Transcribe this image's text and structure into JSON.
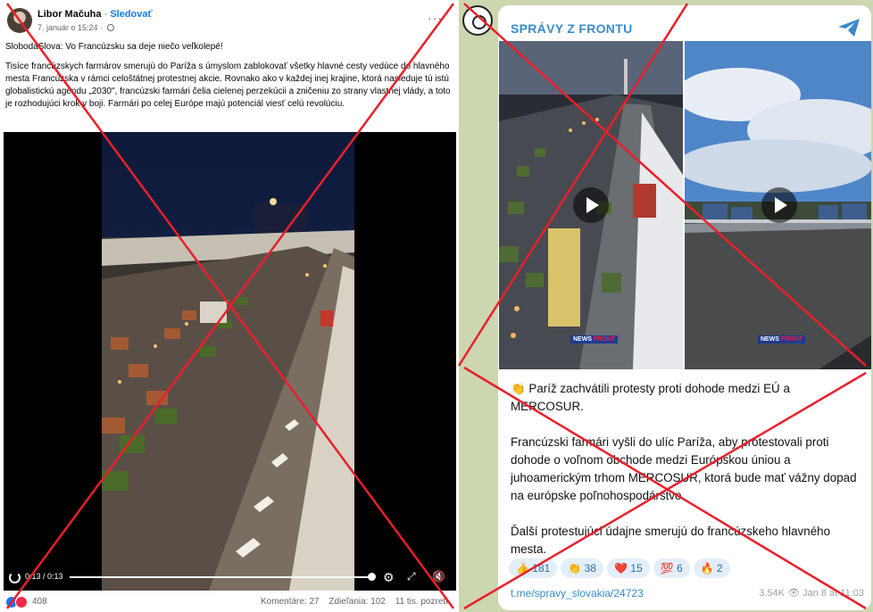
{
  "facebook": {
    "author": "Libor Mačuha",
    "separator": "·",
    "follow": "Sledovať",
    "date": "7. január o 15:24 ·",
    "more": "···",
    "line1": "SlobodaSlova: Vo Francúzsku sa deje niečo veľkolepé!",
    "body": "Tisíce francúzskych farmárov smerujú do Paríža s úmyslom zablokovať všetky hlavné cesty vedúce do hlavného mesta Francúzska v rámci celoštátnej protestnej akcie. Rovnako ako v každej inej krajine, ktorá nasleduje tú istú globalistickú agendu „2030\", francúzski farmári čelia cielenej perzekúcii a zničeniu zo strany vlastnej vlády, a toto je rozhodujúci krok v boji. Farmári po celej Európe majú potenciál viesť celú revolúciu.",
    "video": {
      "time": "0:13 / 0:13",
      "progress": 1.0,
      "settings_icon": "gear-icon",
      "fullscreen_icon": "expand-icon",
      "mute_icon": "muted-speaker-icon",
      "replay_icon": "replay-icon"
    },
    "reactions_count": "408",
    "comments": "Komentáre: 27",
    "shares": "Zdieľania: 102",
    "views": "11 tis. pozretí"
  },
  "telegram": {
    "channel": "SPRÁVY Z FRONTU",
    "share_icon": "telegram-share-icon",
    "watermark": {
      "news": "NEWS",
      "front": "FRONT"
    },
    "paragraph1": "👏 Paríž zachvátili protesty proti dohode medzi EÚ a MERCOSUR.",
    "paragraph2": "Francúzski farmári vyšli do ulíc Paríža, aby protestovali proti dohode o voľnom obchode medzi Európskou úniou a juhoamerickým trhom MERCOSUR, ktorá bude mať vážny dopad na európske poľnohospodárstvo.",
    "paragraph3": "Ďalší protestujúci údajne smerujú do francúzskeho hlavného mesta.",
    "reactions": [
      {
        "emoji": "👍",
        "count": "181"
      },
      {
        "emoji": "👏",
        "count": "38"
      },
      {
        "emoji": "❤️",
        "count": "15"
      },
      {
        "emoji": "💯",
        "count": "6"
      },
      {
        "emoji": "🔥",
        "count": "2"
      }
    ],
    "link": "t.me/spravy_slovakia/24723",
    "views": "3.54K",
    "views_icon": "eye-icon",
    "date": "Jan 8 at 11:03"
  },
  "colors": {
    "cross": "#e8202a",
    "fb_blue": "#1877f2",
    "tg_blue": "#3a8ac9",
    "tg_bg": "#ccd6b0"
  }
}
